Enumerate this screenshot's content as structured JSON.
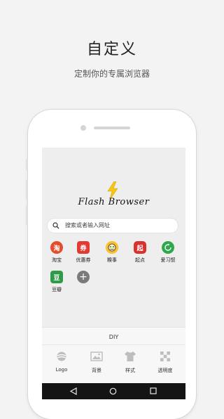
{
  "hero": {
    "title": "自定义",
    "subtitle": "定制你的专属浏览器"
  },
  "screen": {
    "logo_text": "Flash Browser",
    "search": {
      "placeholder": "搜索或者输入网址",
      "icon": "search-icon"
    },
    "shortcuts": [
      {
        "label": "淘宝",
        "glyph": "淘",
        "color": "#e84b2c",
        "icon": "taobao-icon"
      },
      {
        "label": "优惠券",
        "glyph": "券",
        "color": "#e23b33",
        "icon": "coupon-icon"
      },
      {
        "label": "糗事",
        "glyph": "",
        "color": "#f3c329",
        "icon": "qiushi-face-icon"
      },
      {
        "label": "起点",
        "glyph": "起",
        "color": "#d8322f",
        "icon": "qidian-icon"
      },
      {
        "label": "爱习惯",
        "glyph": "",
        "color": "#2ea84a",
        "icon": "habit-icon"
      },
      {
        "label": "豆瓣",
        "glyph": "豆",
        "color": "#2f9a48",
        "icon": "douban-icon"
      },
      {
        "label": "",
        "glyph": "+",
        "color": "#7a7a7a",
        "icon": "add-icon"
      }
    ],
    "diy": {
      "title": "DIY",
      "tools": [
        {
          "label": "Logo",
          "icon": "logo-icon"
        },
        {
          "label": "背景",
          "icon": "image-icon"
        },
        {
          "label": "样式",
          "icon": "shirt-icon"
        },
        {
          "label": "透明度",
          "icon": "transparency-icon"
        }
      ]
    },
    "nav": {
      "back": "back-icon",
      "home": "home-icon",
      "recents": "recents-icon"
    }
  },
  "colors": {
    "bolt": "#f5c518",
    "nav_bg": "#141414"
  }
}
